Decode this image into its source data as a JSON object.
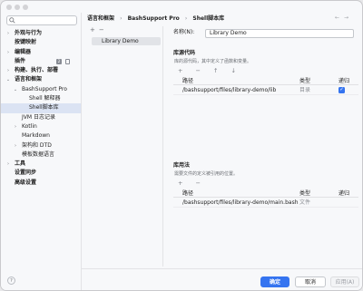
{
  "sidebar": {
    "search_placeholder": "",
    "items": [
      {
        "label": "外观与行为",
        "bold": true,
        "indent": 0,
        "arrow": "›"
      },
      {
        "label": "按键映射",
        "bold": true,
        "indent": 0,
        "arrow": ""
      },
      {
        "label": "编辑器",
        "bold": true,
        "indent": 0,
        "arrow": "›"
      },
      {
        "label": "插件",
        "bold": true,
        "indent": 0,
        "arrow": ""
      },
      {
        "label": "构建、执行、部署",
        "bold": true,
        "indent": 0,
        "arrow": "›"
      },
      {
        "label": "语言和框架",
        "bold": true,
        "indent": 0,
        "arrow": "⌄"
      },
      {
        "label": "BashSupport Pro",
        "bold": false,
        "indent": 1,
        "arrow": "⌄"
      },
      {
        "label": "Shell 解释器",
        "bold": false,
        "indent": 2,
        "arrow": ""
      },
      {
        "label": "Shell脚本库",
        "bold": false,
        "indent": 2,
        "arrow": "",
        "selected": true
      },
      {
        "label": "JVM 日志记录",
        "bold": false,
        "indent": 1,
        "arrow": ""
      },
      {
        "label": "Kotlin",
        "bold": false,
        "indent": 1,
        "arrow": "›"
      },
      {
        "label": "Markdown",
        "bold": false,
        "indent": 1,
        "arrow": ""
      },
      {
        "label": "架构和 DTD",
        "bold": false,
        "indent": 1,
        "arrow": "›"
      },
      {
        "label": "模板数据语言",
        "bold": false,
        "indent": 1,
        "arrow": ""
      },
      {
        "label": "工具",
        "bold": true,
        "indent": 0,
        "arrow": "›"
      },
      {
        "label": "设置同步",
        "bold": true,
        "indent": 0,
        "arrow": ""
      },
      {
        "label": "高级设置",
        "bold": true,
        "indent": 0,
        "arrow": ""
      }
    ],
    "plugin_badge": "2",
    "help_label": "?"
  },
  "breadcrumb": {
    "items": [
      "语言和框架",
      "BashSupport Pro",
      "Shell脚本库"
    ],
    "separator": "›"
  },
  "nav": {
    "back": "←",
    "forward": "→"
  },
  "list": {
    "add": "+",
    "remove": "−",
    "items": [
      "Library Demo"
    ]
  },
  "form": {
    "name_label": "名称(N):",
    "name_value": "Library Demo",
    "source": {
      "title": "库源代码",
      "subtitle": "库的源代码，其中定义了函数和变量。",
      "tools": "+ − ↑ ↓",
      "columns": [
        "路径",
        "类型",
        "递归"
      ],
      "rows": [
        {
          "path": "/bashsupport/files/library-demo/lib",
          "type": "目录",
          "recursive": true
        }
      ]
    },
    "usage": {
      "title": "库用法",
      "subtitle": "需要文件的定义被引用的位置。",
      "tools": "+ −",
      "columns": [
        "路径",
        "类型",
        "递归"
      ],
      "rows": [
        {
          "path": "/bashsupport/files/library-demo/main.bash",
          "type": "文件"
        }
      ]
    }
  },
  "footer": {
    "ok": "确定",
    "cancel": "取消",
    "apply": "应用(A)"
  },
  "colors": {
    "accent": "#3574f0",
    "selection": "#dbe3f3"
  }
}
